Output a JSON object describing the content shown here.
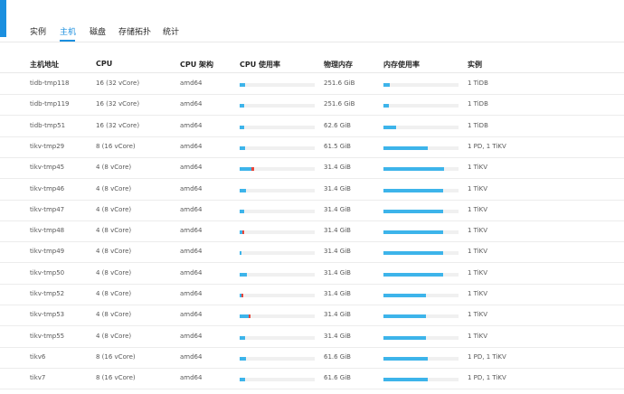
{
  "tabs": [
    {
      "label": "实例",
      "active": false
    },
    {
      "label": "主机",
      "active": true
    },
    {
      "label": "磁盘",
      "active": false
    },
    {
      "label": "存储拓扑",
      "active": false
    },
    {
      "label": "统计",
      "active": false
    }
  ],
  "columns": [
    "主机地址",
    "CPU",
    "CPU 架构",
    "CPU 使用率",
    "物理内存",
    "内存使用率",
    "实例"
  ],
  "colors": {
    "accent": "#1b8fdf",
    "bar": "#3db4ea",
    "bar_alert": "#e8463a",
    "track": "#f0f0f0"
  },
  "rows": [
    {
      "host": "tidb-tmp118",
      "cpu": "16 (32 vCore)",
      "arch": "amd64",
      "cpu_usage": 0.07,
      "cpu_alert": 0.0,
      "memory": "251.6 GiB",
      "mem_usage": 0.09,
      "instances": "1 TiDB"
    },
    {
      "host": "tidb-tmp119",
      "cpu": "16 (32 vCore)",
      "arch": "amd64",
      "cpu_usage": 0.06,
      "cpu_alert": 0.0,
      "memory": "251.6 GiB",
      "mem_usage": 0.07,
      "instances": "1 TiDB"
    },
    {
      "host": "tidb-tmp51",
      "cpu": "16 (32 vCore)",
      "arch": "amd64",
      "cpu_usage": 0.06,
      "cpu_alert": 0.0,
      "memory": "62.6 GiB",
      "mem_usage": 0.17,
      "instances": "1 TiDB"
    },
    {
      "host": "tikv-tmp29",
      "cpu": "8 (16 vCore)",
      "arch": "amd64",
      "cpu_usage": 0.07,
      "cpu_alert": 0.0,
      "memory": "61.5 GiB",
      "mem_usage": 0.59,
      "instances": "1 PD, 1 TiKV"
    },
    {
      "host": "tikv-tmp45",
      "cpu": "4 (8 vCore)",
      "arch": "amd64",
      "cpu_usage": 0.16,
      "cpu_alert": 0.03,
      "memory": "31.4 GiB",
      "mem_usage": 0.81,
      "instances": "1 TiKV"
    },
    {
      "host": "tikv-tmp46",
      "cpu": "4 (8 vCore)",
      "arch": "amd64",
      "cpu_usage": 0.08,
      "cpu_alert": 0.0,
      "memory": "31.4 GiB",
      "mem_usage": 0.79,
      "instances": "1 TiKV"
    },
    {
      "host": "tikv-tmp47",
      "cpu": "4 (8 vCore)",
      "arch": "amd64",
      "cpu_usage": 0.06,
      "cpu_alert": 0.0,
      "memory": "31.4 GiB",
      "mem_usage": 0.8,
      "instances": "1 TiKV"
    },
    {
      "host": "tikv-tmp48",
      "cpu": "4 (8 vCore)",
      "arch": "amd64",
      "cpu_usage": 0.04,
      "cpu_alert": 0.02,
      "memory": "31.4 GiB",
      "mem_usage": 0.8,
      "instances": "1 TiKV"
    },
    {
      "host": "tikv-tmp49",
      "cpu": "4 (8 vCore)",
      "arch": "amd64",
      "cpu_usage": 0.03,
      "cpu_alert": 0.0,
      "memory": "31.4 GiB",
      "mem_usage": 0.8,
      "instances": "1 TiKV"
    },
    {
      "host": "tikv-tmp50",
      "cpu": "4 (8 vCore)",
      "arch": "amd64",
      "cpu_usage": 0.1,
      "cpu_alert": 0.0,
      "memory": "31.4 GiB",
      "mem_usage": 0.8,
      "instances": "1 TiKV"
    },
    {
      "host": "tikv-tmp52",
      "cpu": "4 (8 vCore)",
      "arch": "amd64",
      "cpu_usage": 0.03,
      "cpu_alert": 0.02,
      "memory": "31.4 GiB",
      "mem_usage": 0.57,
      "instances": "1 TiKV"
    },
    {
      "host": "tikv-tmp53",
      "cpu": "4 (8 vCore)",
      "arch": "amd64",
      "cpu_usage": 0.12,
      "cpu_alert": 0.02,
      "memory": "31.4 GiB",
      "mem_usage": 0.57,
      "instances": "1 TiKV"
    },
    {
      "host": "tikv-tmp55",
      "cpu": "4 (8 vCore)",
      "arch": "amd64",
      "cpu_usage": 0.07,
      "cpu_alert": 0.0,
      "memory": "31.4 GiB",
      "mem_usage": 0.57,
      "instances": "1 TiKV"
    },
    {
      "host": "tikv6",
      "cpu": "8 (16 vCore)",
      "arch": "amd64",
      "cpu_usage": 0.09,
      "cpu_alert": 0.0,
      "memory": "61.6 GiB",
      "mem_usage": 0.59,
      "instances": "1 PD, 1 TiKV"
    },
    {
      "host": "tikv7",
      "cpu": "8 (16 vCore)",
      "arch": "amd64",
      "cpu_usage": 0.07,
      "cpu_alert": 0.0,
      "memory": "61.6 GiB",
      "mem_usage": 0.59,
      "instances": "1 PD, 1 TiKV"
    }
  ]
}
